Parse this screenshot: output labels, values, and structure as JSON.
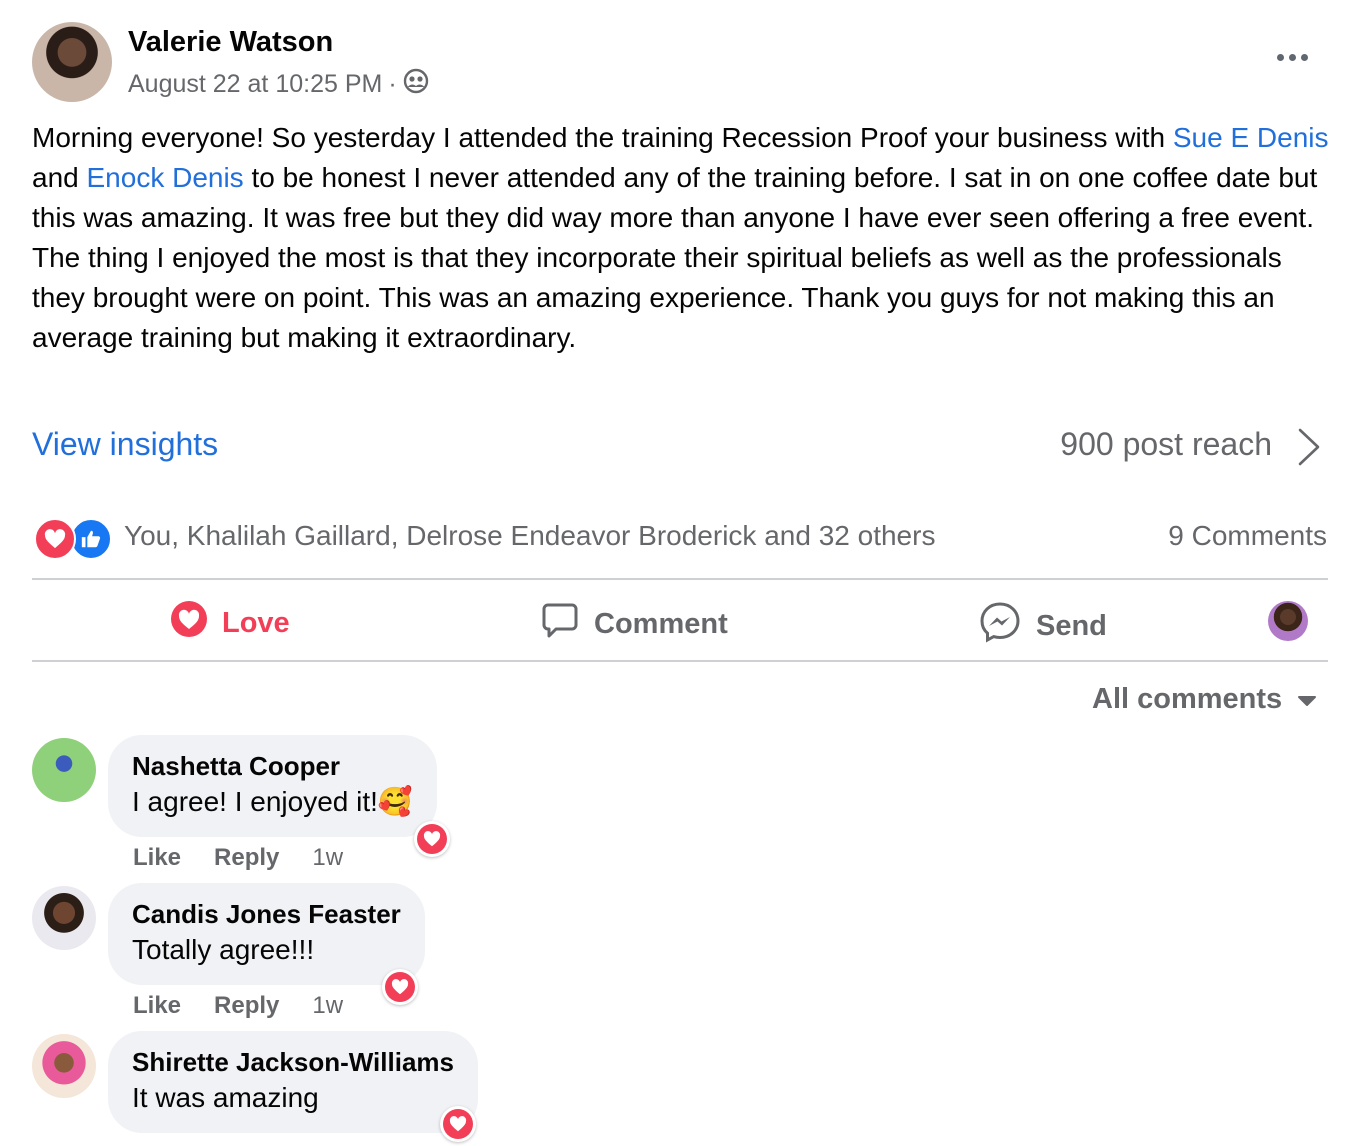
{
  "post": {
    "author": "Valerie Watson",
    "timestamp": "August 22 at 10:25 PM",
    "separator": "·",
    "privacy_icon": "friends-icon",
    "text_part1": "Morning everyone! So yesterday I attended the training Recession Proof your business with ",
    "mention1": "Sue E Denis",
    "text_part2": " and ",
    "mention2": "Enock Denis",
    "text_part3": " to be honest I never attended any of the training before. I sat in on one coffee date but this was amazing. It was free but they did way more than anyone I have ever seen offering a free event. The thing I enjoyed the most is that they incorporate their spiritual beliefs as well as the professionals they brought were on point. This was an amazing experience. Thank you guys for not making this an average training but making it extraordinary."
  },
  "insights": {
    "link_label": "View insights",
    "reach": "900 post reach"
  },
  "reactions": {
    "summary": "You, Khalilah Gaillard, Delrose Endeavor Broderick and 32 others",
    "comments_count": "9 Comments"
  },
  "actions": {
    "love": "Love",
    "comment": "Comment",
    "send": "Send"
  },
  "comments_filter": "All comments",
  "comments": [
    {
      "name": "Nashetta Cooper",
      "text": "I agree! I enjoyed it!🥰",
      "like": "Like",
      "reply": "Reply",
      "time": "1w"
    },
    {
      "name": "Candis Jones Feaster",
      "text": "Totally agree!!!",
      "like": "Like",
      "reply": "Reply",
      "time": "1w"
    },
    {
      "name": "Shirette Jackson-Williams",
      "text": "It was amazing"
    }
  ],
  "colors": {
    "link": "#216fdb",
    "love": "#f33e58",
    "like": "#1877f2",
    "secondary_text": "#65676b",
    "bubble": "#f0f2f5"
  }
}
